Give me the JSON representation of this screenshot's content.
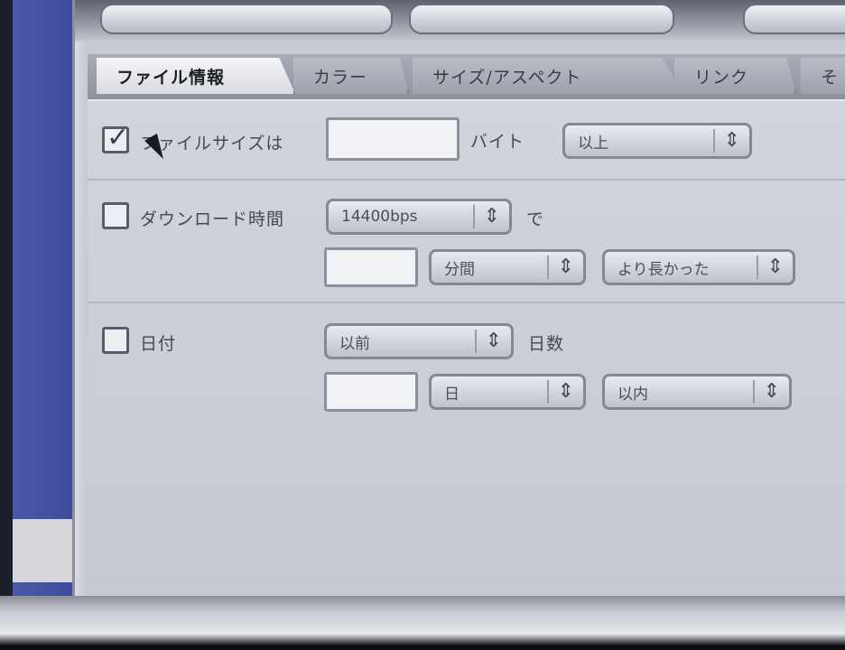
{
  "tabs": [
    {
      "label": "ファイル情報"
    },
    {
      "label": "カラー"
    },
    {
      "label": "サイズ/アスペクト"
    },
    {
      "label": "リンク"
    },
    {
      "label": "そ"
    }
  ],
  "criteria": {
    "file_size": {
      "checked": true,
      "label": "ファイルサイズは",
      "unit": "バイト",
      "operator": "以上"
    },
    "download": {
      "checked": false,
      "label": "ダウンロード時間",
      "speed": "14400bps",
      "suffix": "で",
      "operator": "分間",
      "compare": "より長かった"
    },
    "date": {
      "checked": false,
      "label": "日付",
      "operator": "以前",
      "suffix": "日数",
      "value2": "日",
      "period": "以内"
    }
  }
}
